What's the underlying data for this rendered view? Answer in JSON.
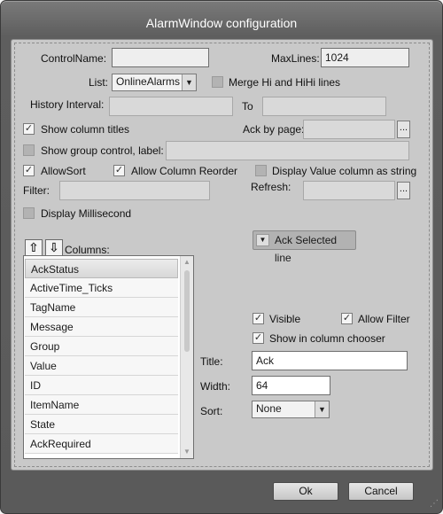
{
  "window": {
    "title": "AlarmWindow configuration"
  },
  "form": {
    "control_name_label": "ControlName:",
    "control_name_value": "",
    "max_lines_label": "MaxLines:",
    "max_lines_value": "1024",
    "list_label": "List:",
    "list_value": "OnlineAlarms",
    "merge_label": "Merge Hi and HiHi lines",
    "merge_checked": false,
    "history_interval_label": "History Interval:",
    "history_from_value": "",
    "to_label": "To",
    "history_to_value": "",
    "show_column_titles_label": "Show column titles",
    "show_column_titles_checked": true,
    "ack_by_page_label": "Ack by page:",
    "ack_by_page_value": "",
    "ack_by_page_button": "...",
    "show_group_control_label": "Show group control, label:",
    "show_group_control_checked": false,
    "group_label_value": "",
    "allow_sort_label": "AllowSort",
    "allow_sort_checked": true,
    "allow_column_reorder_label": "Allow Column Reorder",
    "allow_column_reorder_checked": true,
    "display_value_string_label": "Display Value column as string",
    "display_value_string_checked": false,
    "filter_label": "Filter:",
    "filter_value": "",
    "refresh_label": "Refresh:",
    "refresh_value": "",
    "refresh_button": "...",
    "display_millisecond_label": "Display Millisecond",
    "display_millisecond_checked": false
  },
  "columns": {
    "label": "Columns:",
    "up_icon": "arrow-up-icon",
    "down_icon": "arrow-down-icon",
    "items": [
      "AckStatus",
      "ActiveTime_Ticks",
      "TagName",
      "Message",
      "Group",
      "Value",
      "ID",
      "ItemName",
      "State",
      "AckRequired"
    ],
    "selected_index": 0
  },
  "ack_selected": {
    "label": "Ack Selected line",
    "icon": "dropdown-triangle-icon"
  },
  "column_props": {
    "visible_label": "Visible",
    "visible_checked": true,
    "allow_filter_label": "Allow Filter",
    "allow_filter_checked": true,
    "show_in_chooser_label": "Show in column chooser",
    "show_in_chooser_checked": true,
    "title_label": "Title:",
    "title_value": "Ack",
    "width_label": "Width:",
    "width_value": "64",
    "sort_label": "Sort:",
    "sort_value": "None"
  },
  "footer": {
    "ok_label": "Ok",
    "cancel_label": "Cancel"
  },
  "colors": {
    "chrome": "#5e5e5e",
    "panel": "#c9c9c9",
    "title_text": "#ffffff"
  }
}
